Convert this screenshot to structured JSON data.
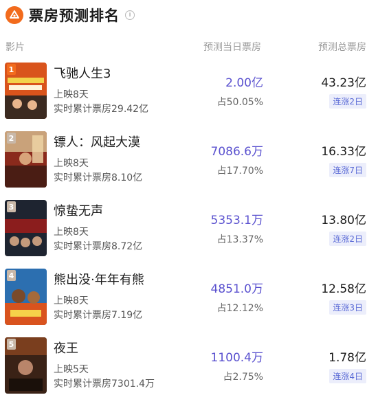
{
  "header": {
    "title": "票房预测排名",
    "info_glyph": "i"
  },
  "columns": {
    "film": "影片",
    "predicted_today": "预测当日票房",
    "predicted_total": "预测总票房"
  },
  "colors": {
    "accent": "#5a51cf",
    "rank1": "#f26b1d",
    "rank_other": "#c9b8a8"
  },
  "films": [
    {
      "rank": "1",
      "name": "飞驰人生3",
      "days": "上映8天",
      "cumulative": "实时累计票房29.42亿",
      "predicted_today": "2.00亿",
      "share": "占50.05%",
      "predicted_total": "43.23亿",
      "streak": "连涨2日"
    },
    {
      "rank": "2",
      "name": "镖人：风起大漠",
      "days": "上映8天",
      "cumulative": "实时累计票房8.10亿",
      "predicted_today": "7086.6万",
      "share": "占17.70%",
      "predicted_total": "16.33亿",
      "streak": "连涨7日"
    },
    {
      "rank": "3",
      "name": "惊蛰无声",
      "days": "上映8天",
      "cumulative": "实时累计票房8.72亿",
      "predicted_today": "5353.1万",
      "share": "占13.37%",
      "predicted_total": "13.80亿",
      "streak": "连涨2日"
    },
    {
      "rank": "4",
      "name": "熊出没·年年有熊",
      "days": "上映8天",
      "cumulative": "实时累计票房7.19亿",
      "predicted_today": "4851.0万",
      "share": "占12.12%",
      "predicted_total": "12.58亿",
      "streak": "连涨3日"
    },
    {
      "rank": "5",
      "name": "夜王",
      "days": "上映5天",
      "cumulative": "实时累计票房7301.4万",
      "predicted_today": "1100.4万",
      "share": "占2.75%",
      "predicted_total": "1.78亿",
      "streak": "连涨4日"
    }
  ]
}
